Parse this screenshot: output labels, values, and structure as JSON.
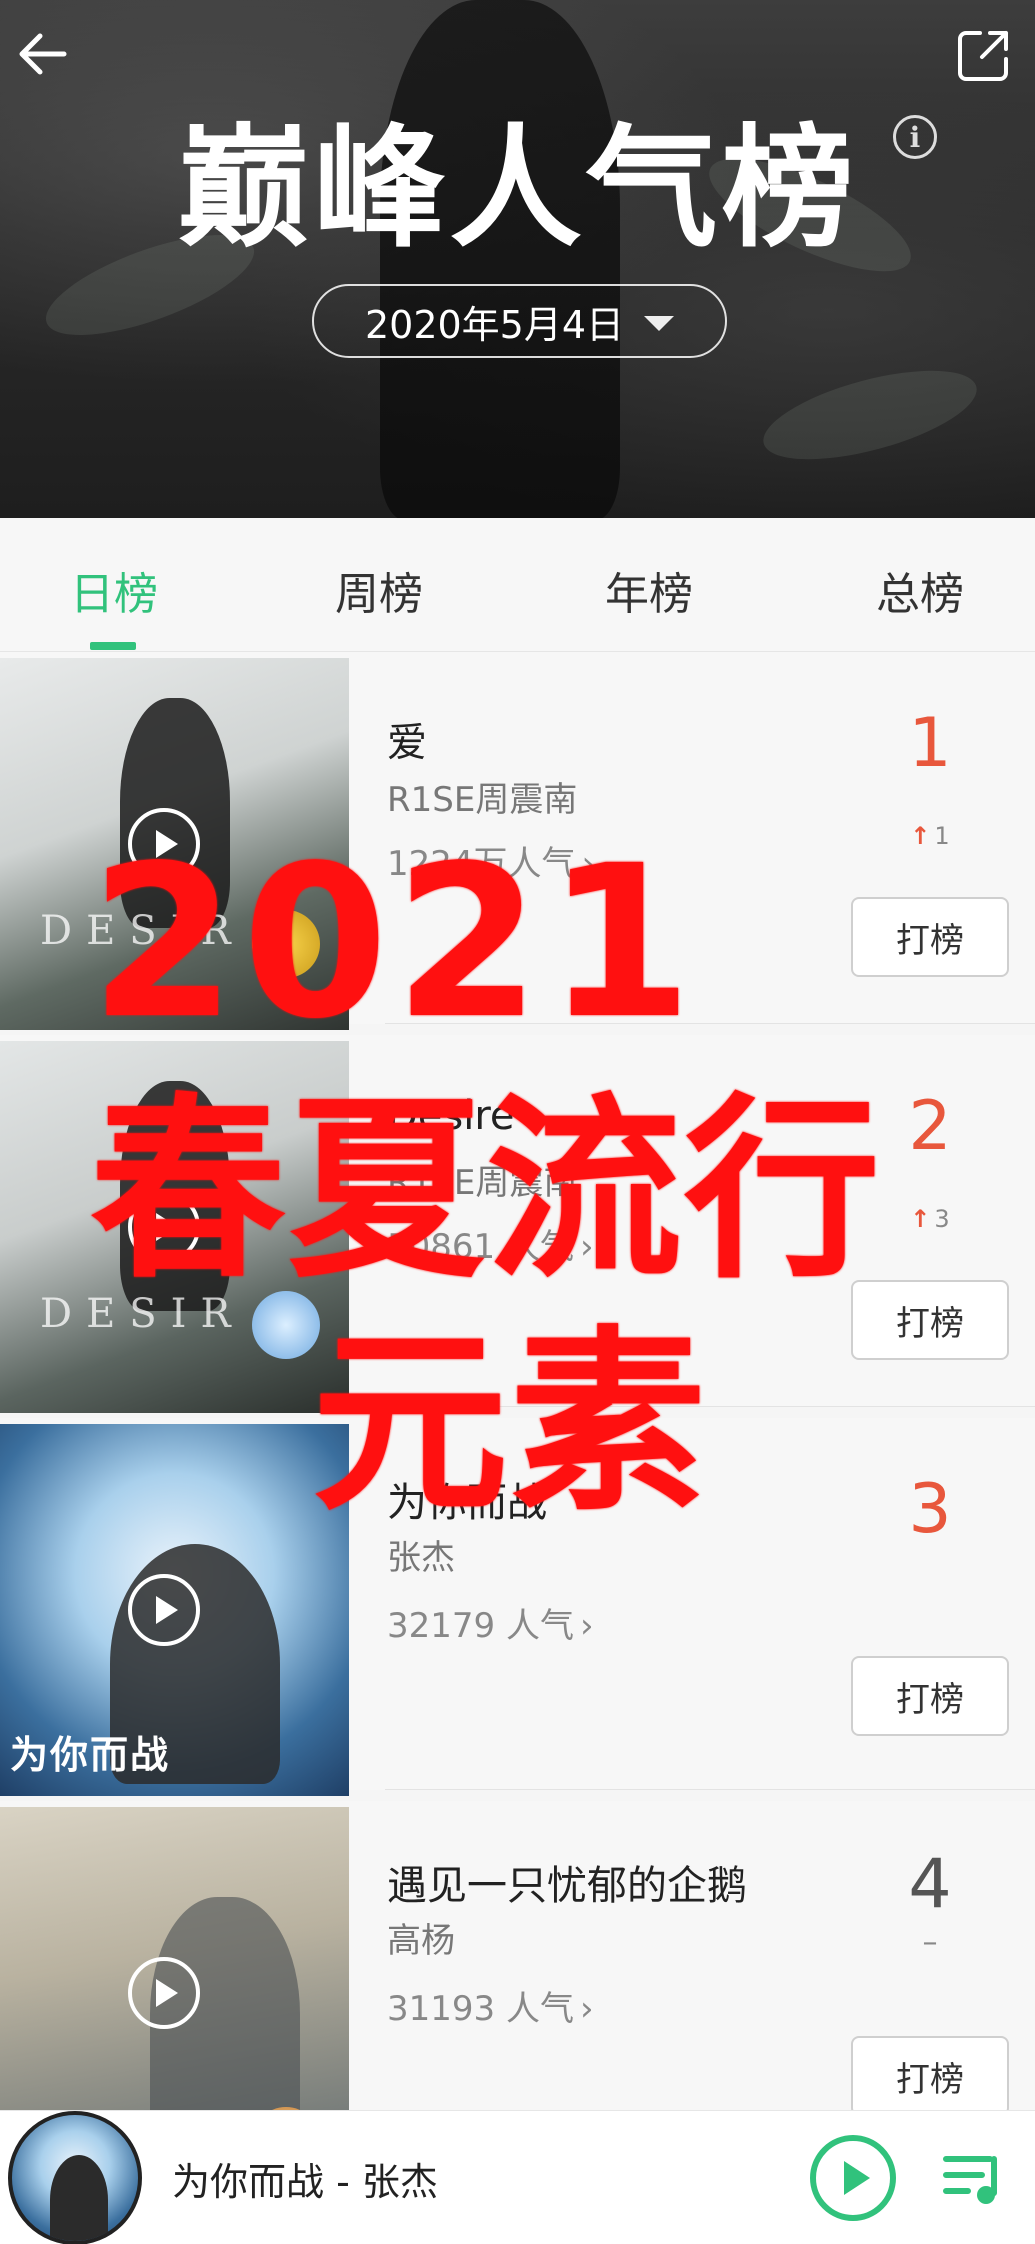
{
  "header": {
    "title": "巅峰人气榜",
    "info_label": "i",
    "date": "2020年5月4日"
  },
  "tabs": [
    {
      "label": "日榜",
      "active": true
    },
    {
      "label": "周榜",
      "active": false
    },
    {
      "label": "年榜",
      "active": false
    },
    {
      "label": "总榜",
      "active": false
    }
  ],
  "songs": [
    {
      "title": "爱",
      "artist": "R1SE周震南",
      "popularity": "1224万人气",
      "rank": "1",
      "trend": "1",
      "trend_dir": "up",
      "vote_label": "打榜",
      "cover_text": "DESIR"
    },
    {
      "title": "Desire",
      "artist": "R1SE周震南",
      "popularity": "50861 人气",
      "rank": "2",
      "trend": "3",
      "trend_dir": "up",
      "vote_label": "打榜",
      "cover_text": "DESIR"
    },
    {
      "title": "为你而战",
      "artist": "张杰",
      "popularity": "32179 人气",
      "rank": "3",
      "trend": "",
      "trend_dir": "none",
      "vote_label": "打榜",
      "cover_text": "为你而战"
    },
    {
      "title": "遇见一只忧郁的企鹅",
      "artist": "高杨",
      "popularity": "31193 人气",
      "rank": "4",
      "trend": "–",
      "trend_dir": "flat",
      "vote_label": "打榜",
      "cover_text": ""
    }
  ],
  "promo": {
    "line1": "2021",
    "line2": "春夏流行",
    "line3": "元素"
  },
  "player": {
    "now_playing": "为你而战 - 张杰"
  },
  "colors": {
    "accent": "#31c27c",
    "rank_hot": "#e8573c",
    "promo": "#ff1010"
  }
}
